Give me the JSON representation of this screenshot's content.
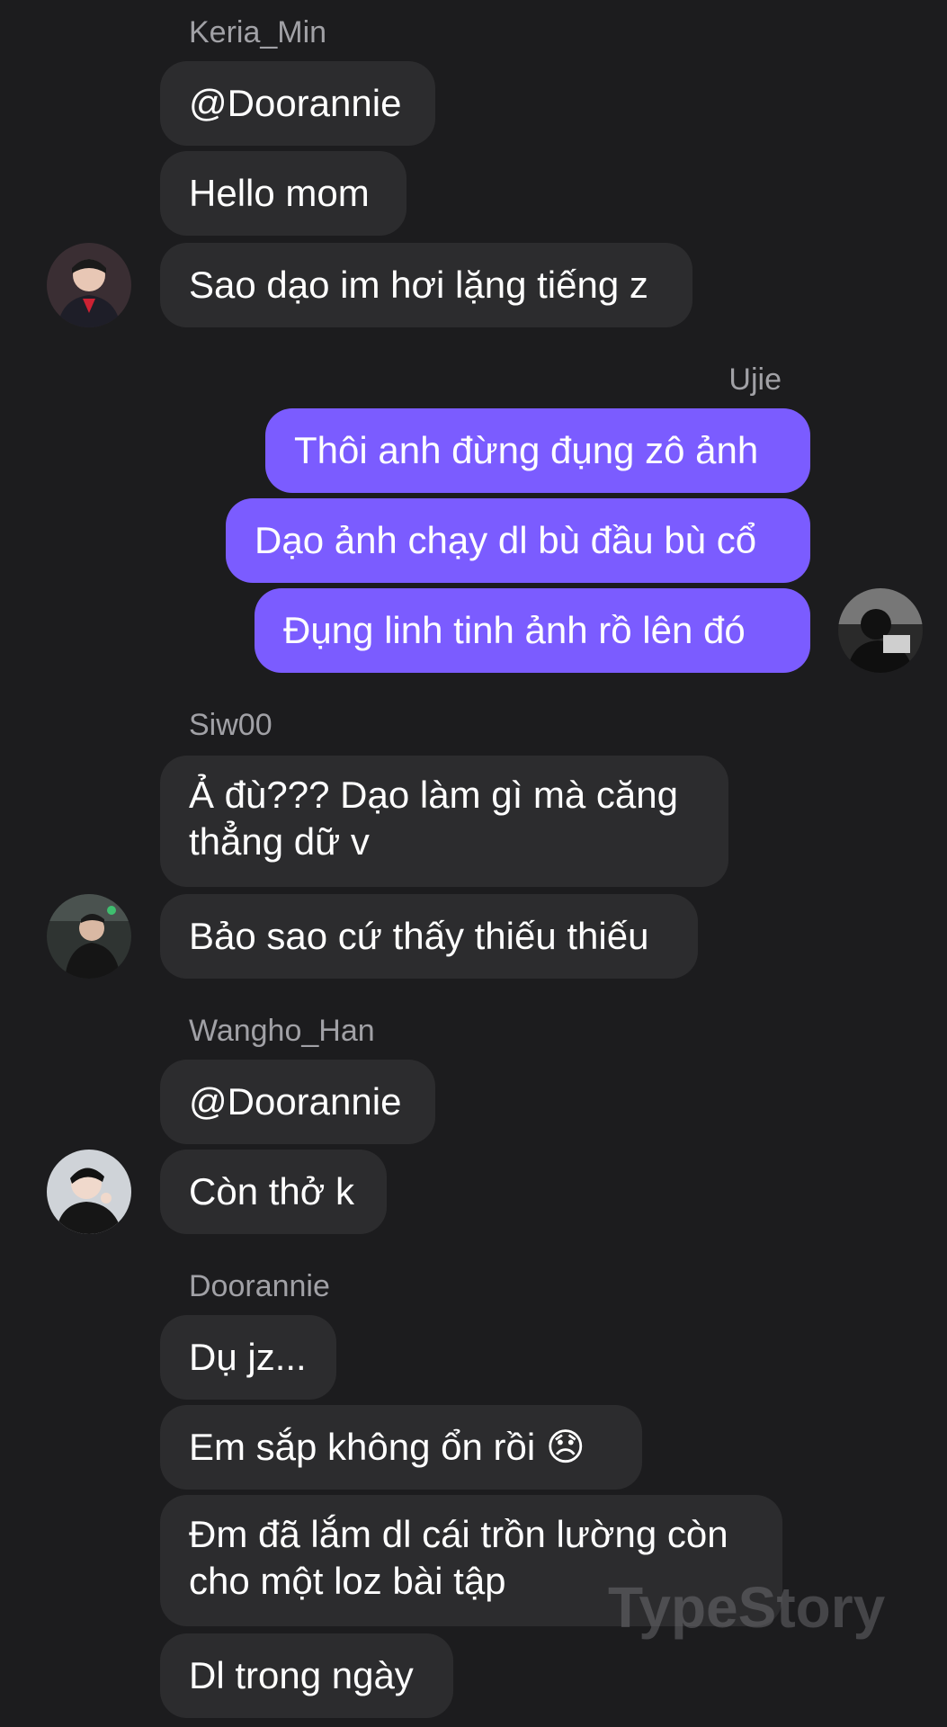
{
  "conversation": {
    "groups": [
      {
        "sender": "Keria_Min",
        "avatar_icon": "user-avatar-icon",
        "messages": [
          "@Doorannie",
          "Hello mom",
          "Sao dạo im hơi lặng tiếng z"
        ]
      },
      {
        "sender": "Ujie",
        "avatar_icon": "user-avatar-icon",
        "messages": [
          "Thôi anh đừng đụng zô ảnh",
          "Dạo ảnh chạy dl bù đầu bù cổ",
          "Đụng linh tinh ảnh rồ lên đó"
        ]
      },
      {
        "sender": "Siw00",
        "avatar_icon": "user-avatar-icon",
        "messages": [
          "Ả đù??? Dạo làm gì mà căng thẳng dữ v",
          "Bảo sao cứ thấy thiếu thiếu"
        ]
      },
      {
        "sender": "Wangho_Han",
        "avatar_icon": "user-avatar-icon",
        "messages": [
          "@Doorannie",
          "Còn thở k"
        ]
      },
      {
        "sender": "Doorannie",
        "messages": [
          "Dụ jz...",
          "Em sắp không ổn rồi 😞",
          "Đm đã lắm dl cái trồn lường còn cho một loz bài tập",
          "Dl trong ngày"
        ]
      }
    ]
  },
  "watermark": "TypeStory",
  "colors": {
    "background": "#1c1c1e",
    "incoming_bubble": "#2c2c2e",
    "outgoing_bubble": "#7b5cff",
    "sender_name": "#a1a1a6"
  }
}
